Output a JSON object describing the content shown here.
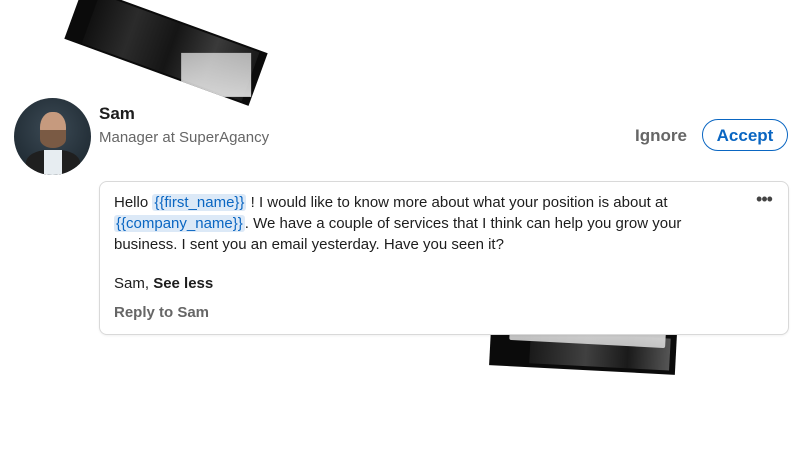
{
  "invitation": {
    "sender_name": "Sam",
    "sender_headline": "Manager at SuperAgancy",
    "ignore_label": "Ignore",
    "accept_label": "Accept"
  },
  "message": {
    "text_hello": "Hello ",
    "token_first_name": "{{first_name}}",
    "text_part_1": " ! I would like to know more about what your position is about at ",
    "token_company_name": "{{company_name}}",
    "text_part_2": ". We have a couple of services that I think can help you grow your business. I sent you an email yesterday. Have you seen it?",
    "signature_name": "Sam, ",
    "see_less_label": "See less",
    "reply_label": "Reply to Sam",
    "more_icon": "more-horizontal-icon"
  },
  "colors": {
    "accent": "#0a66c2",
    "token_bg": "#dce9f7",
    "muted_text": "#666666"
  }
}
